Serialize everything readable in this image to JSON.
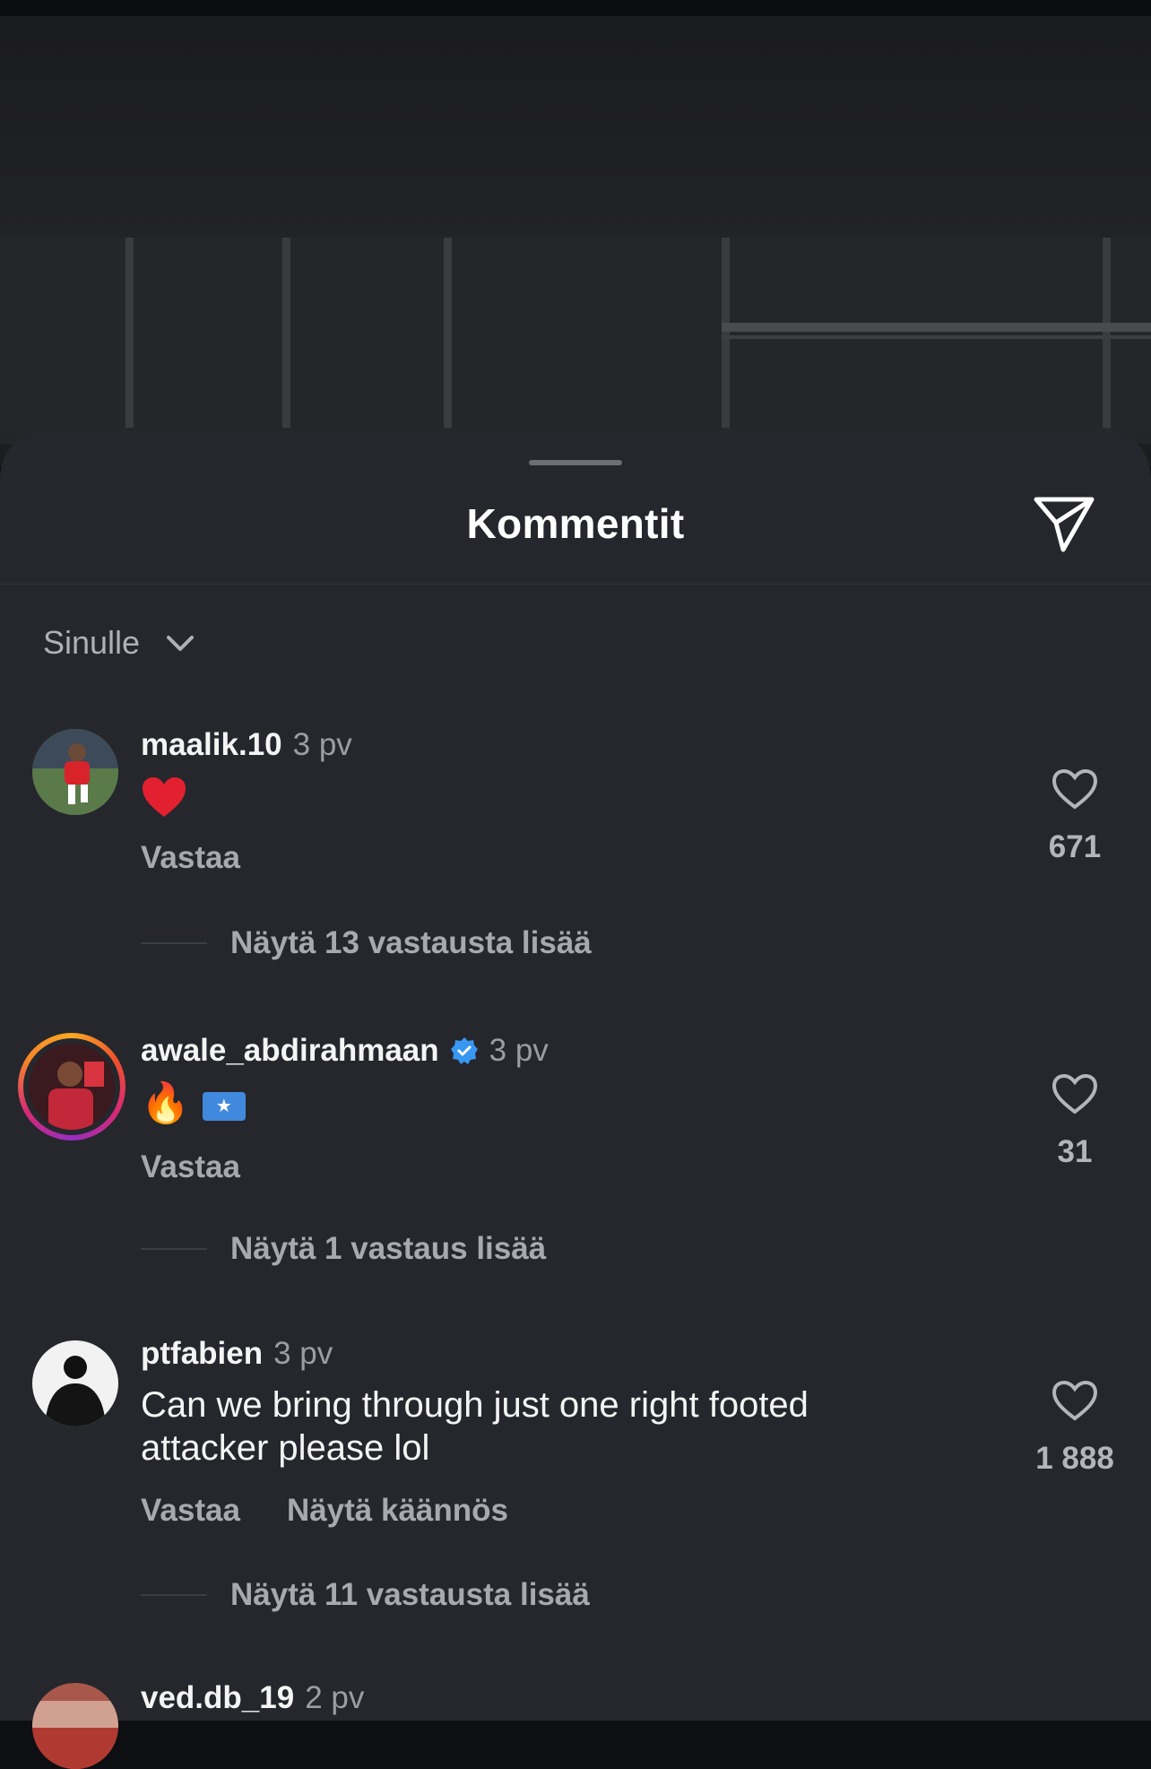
{
  "sheet": {
    "title": "Kommentit",
    "send_icon": "paper-plane-icon",
    "sort": {
      "label": "Sinulle",
      "icon": "chevron-down-icon"
    }
  },
  "comments": [
    {
      "username": "maalik.10",
      "time": "3 pv",
      "verified": false,
      "text": "❤️",
      "reply_label": "Vastaa",
      "likes": "671",
      "view_replies": "Näytä 13 vastausta lisää"
    },
    {
      "username": "awale_abdirahmaan",
      "time": "3 pv",
      "verified": true,
      "text": "🔥 🇸🇴",
      "reply_label": "Vastaa",
      "likes": "31",
      "view_replies": "Näytä 1 vastaus lisää"
    },
    {
      "username": "ptfabien",
      "time": "3 pv",
      "verified": false,
      "text_line1": "Can we bring through just one right footed",
      "text_line2": "attacker please lol",
      "reply_label": "Vastaa",
      "translate_label": "Näytä käännös",
      "likes": "1 888",
      "view_replies": "Näytä 11 vastausta lisää"
    },
    {
      "username": "ved.db_19",
      "time": "2 pv"
    }
  ],
  "colors": {
    "sheet_bg": "#25272d",
    "muted_text": "#a6a9af",
    "verified_blue": "#3897f0"
  }
}
